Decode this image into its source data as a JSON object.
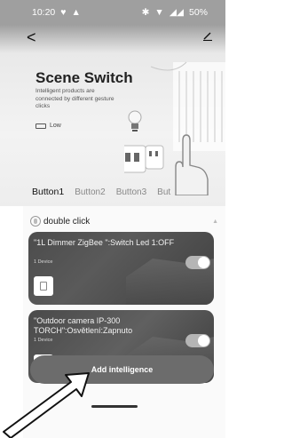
{
  "status_bar": {
    "time": "10:20",
    "battery": "50%"
  },
  "nav": {
    "back_glyph": "<",
    "edit_icon": "edit-icon"
  },
  "hero": {
    "title": "Scene Switch",
    "subtitle": "Intelligent products are connected by different gesture clicks",
    "badge": "Low"
  },
  "tabs": [
    {
      "label": "Button1",
      "active": true
    },
    {
      "label": "Button2",
      "active": false
    },
    {
      "label": "Button3",
      "active": false
    },
    {
      "label": "But",
      "active": false
    }
  ],
  "trigger": {
    "label": "double click"
  },
  "cards": [
    {
      "name": "\"1L Dimmer ZigBee \":Switch Led 1:OFF",
      "count": "1 Device",
      "enabled": true
    },
    {
      "name": "\"Outdoor camera IP-300 TORCH\":Osvětlení:Zapnuto",
      "count": "1 Device",
      "enabled": true
    }
  ],
  "add_button": {
    "label": "Add intelligence"
  }
}
